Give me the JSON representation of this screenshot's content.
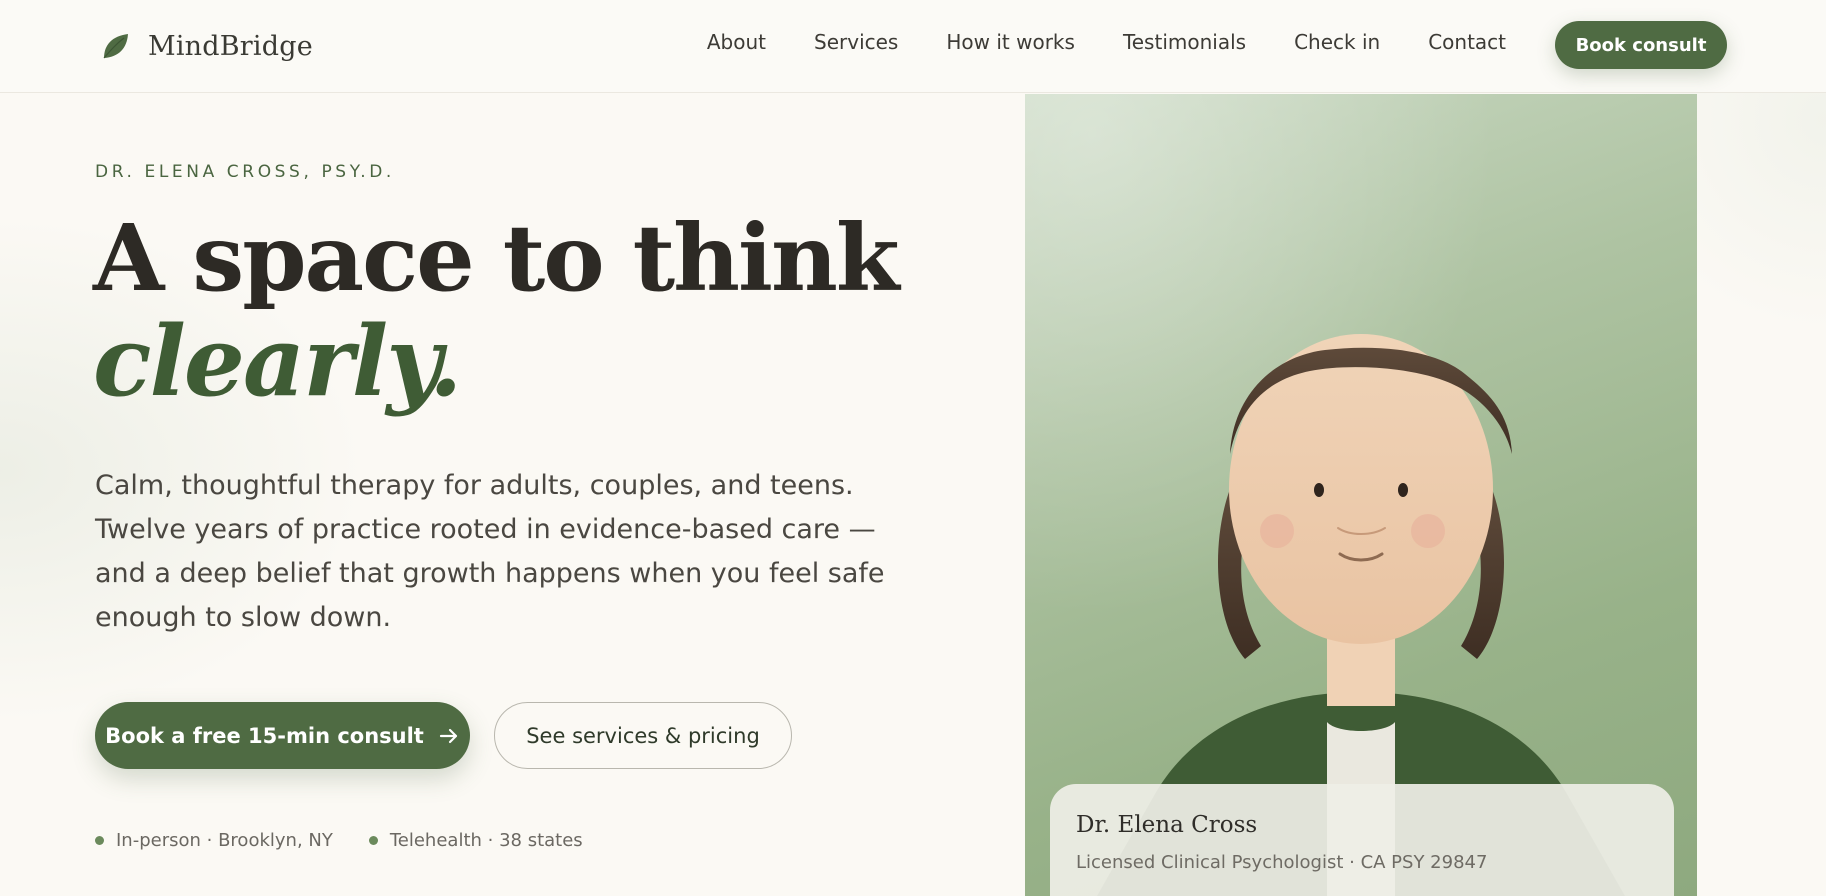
{
  "brand": {
    "name": "MindBridge",
    "icon": "leaf-icon",
    "accent": "#4f6b43"
  },
  "nav": {
    "links": [
      {
        "label": "About"
      },
      {
        "label": "Services"
      },
      {
        "label": "How it works"
      },
      {
        "label": "Testimonials"
      },
      {
        "label": "Check in"
      },
      {
        "label": "Contact"
      }
    ],
    "cta": "Book consult"
  },
  "hero": {
    "eyebrow": "DR. ELENA CROSS, PSY.D.",
    "headline_line1": "A space to think",
    "headline_line2": "clearly.",
    "lede": "Calm, thoughtful therapy for adults, couples, and teens. Twelve years of practice rooted in evidence-based care — and a deep belief that growth happens when you feel safe enough to slow down.",
    "primary_cta": "Book a free 15-min consult",
    "primary_cta_icon": "arrow-right-icon",
    "secondary_cta": "See services & pricing",
    "badges": [
      {
        "label": "In-person · Brooklyn, NY"
      },
      {
        "label": "Telehealth · 38 states"
      }
    ]
  },
  "portrait": {
    "illustration": "illustrated-portrait",
    "name": "Dr. Elena Cross",
    "credentials": "Licensed Clinical Psychologist · CA PSY 29847"
  }
}
